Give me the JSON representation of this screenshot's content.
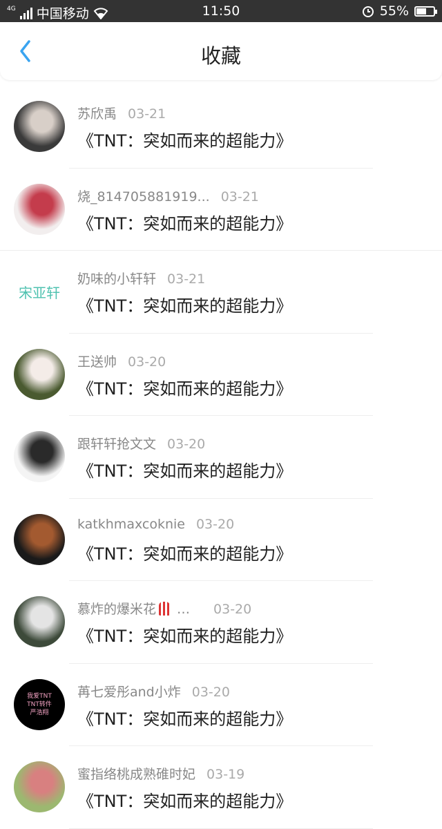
{
  "status_bar": {
    "network": "4G",
    "carrier": "中国移动",
    "time": "11:50",
    "battery": "55%",
    "battery_level": 0.55
  },
  "nav": {
    "title": "收藏",
    "back_icon": "chevron-left-icon",
    "accent": "#3aa4f0"
  },
  "items": [
    {
      "user": "苏欣禹",
      "date": "03-21",
      "title": "《TNT：突如而来的超能力》",
      "avatar_colors": [
        "#3a3a3a",
        "#d8cfc8"
      ]
    },
    {
      "user": "烧_814705881919...",
      "date": "03-21",
      "title": "《TNT：突如而来的超能力》",
      "avatar_colors": [
        "#f2eeee",
        "#c43c4c"
      ]
    },
    {
      "user": "奶味的小轩轩",
      "date": "03-21",
      "title": "《TNT：突如而来的超能力》",
      "avatar_text": "宋亚轩",
      "avatar_colors": [
        "#ffffff",
        "#4fc2b0"
      ]
    },
    {
      "user": "王送帅",
      "date": "03-20",
      "title": "《TNT：突如而来的超能力》",
      "avatar_colors": [
        "#4a5a30",
        "#f4ece8"
      ]
    },
    {
      "user": "跟轩轩抢文文",
      "date": "03-20",
      "title": "《TNT：突如而来的超能力》",
      "avatar_colors": [
        "#f4f4f4",
        "#2a2a2a"
      ]
    },
    {
      "user": "katkhmaxcoknie",
      "date": "03-20",
      "title": "《TNT：突如而来的超能力》",
      "avatar_colors": [
        "#1a1a1a",
        "#a35a30"
      ]
    },
    {
      "user": "慕炸的爆米花",
      "user_suffix": "…",
      "date": "03-20",
      "title": "《TNT：突如而来的超能力》",
      "avatar_colors": [
        "#3d4a3a",
        "#e4e4e4"
      ]
    },
    {
      "user": "苒七爱彤and小炸",
      "date": "03-20",
      "title": "《TNT：突如而来的超能力》",
      "avatar_text_lines": [
        "我爱TNT",
        "TNT转件",
        "严浩翔"
      ],
      "avatar_colors": [
        "#000000",
        "#f0a0c0"
      ]
    },
    {
      "user": "蜜指络桃成熟碓时妃",
      "date": "03-19",
      "title": "《TNT：突如而来的超能力》",
      "avatar_colors": [
        "#9cb870",
        "#d88080"
      ]
    }
  ]
}
